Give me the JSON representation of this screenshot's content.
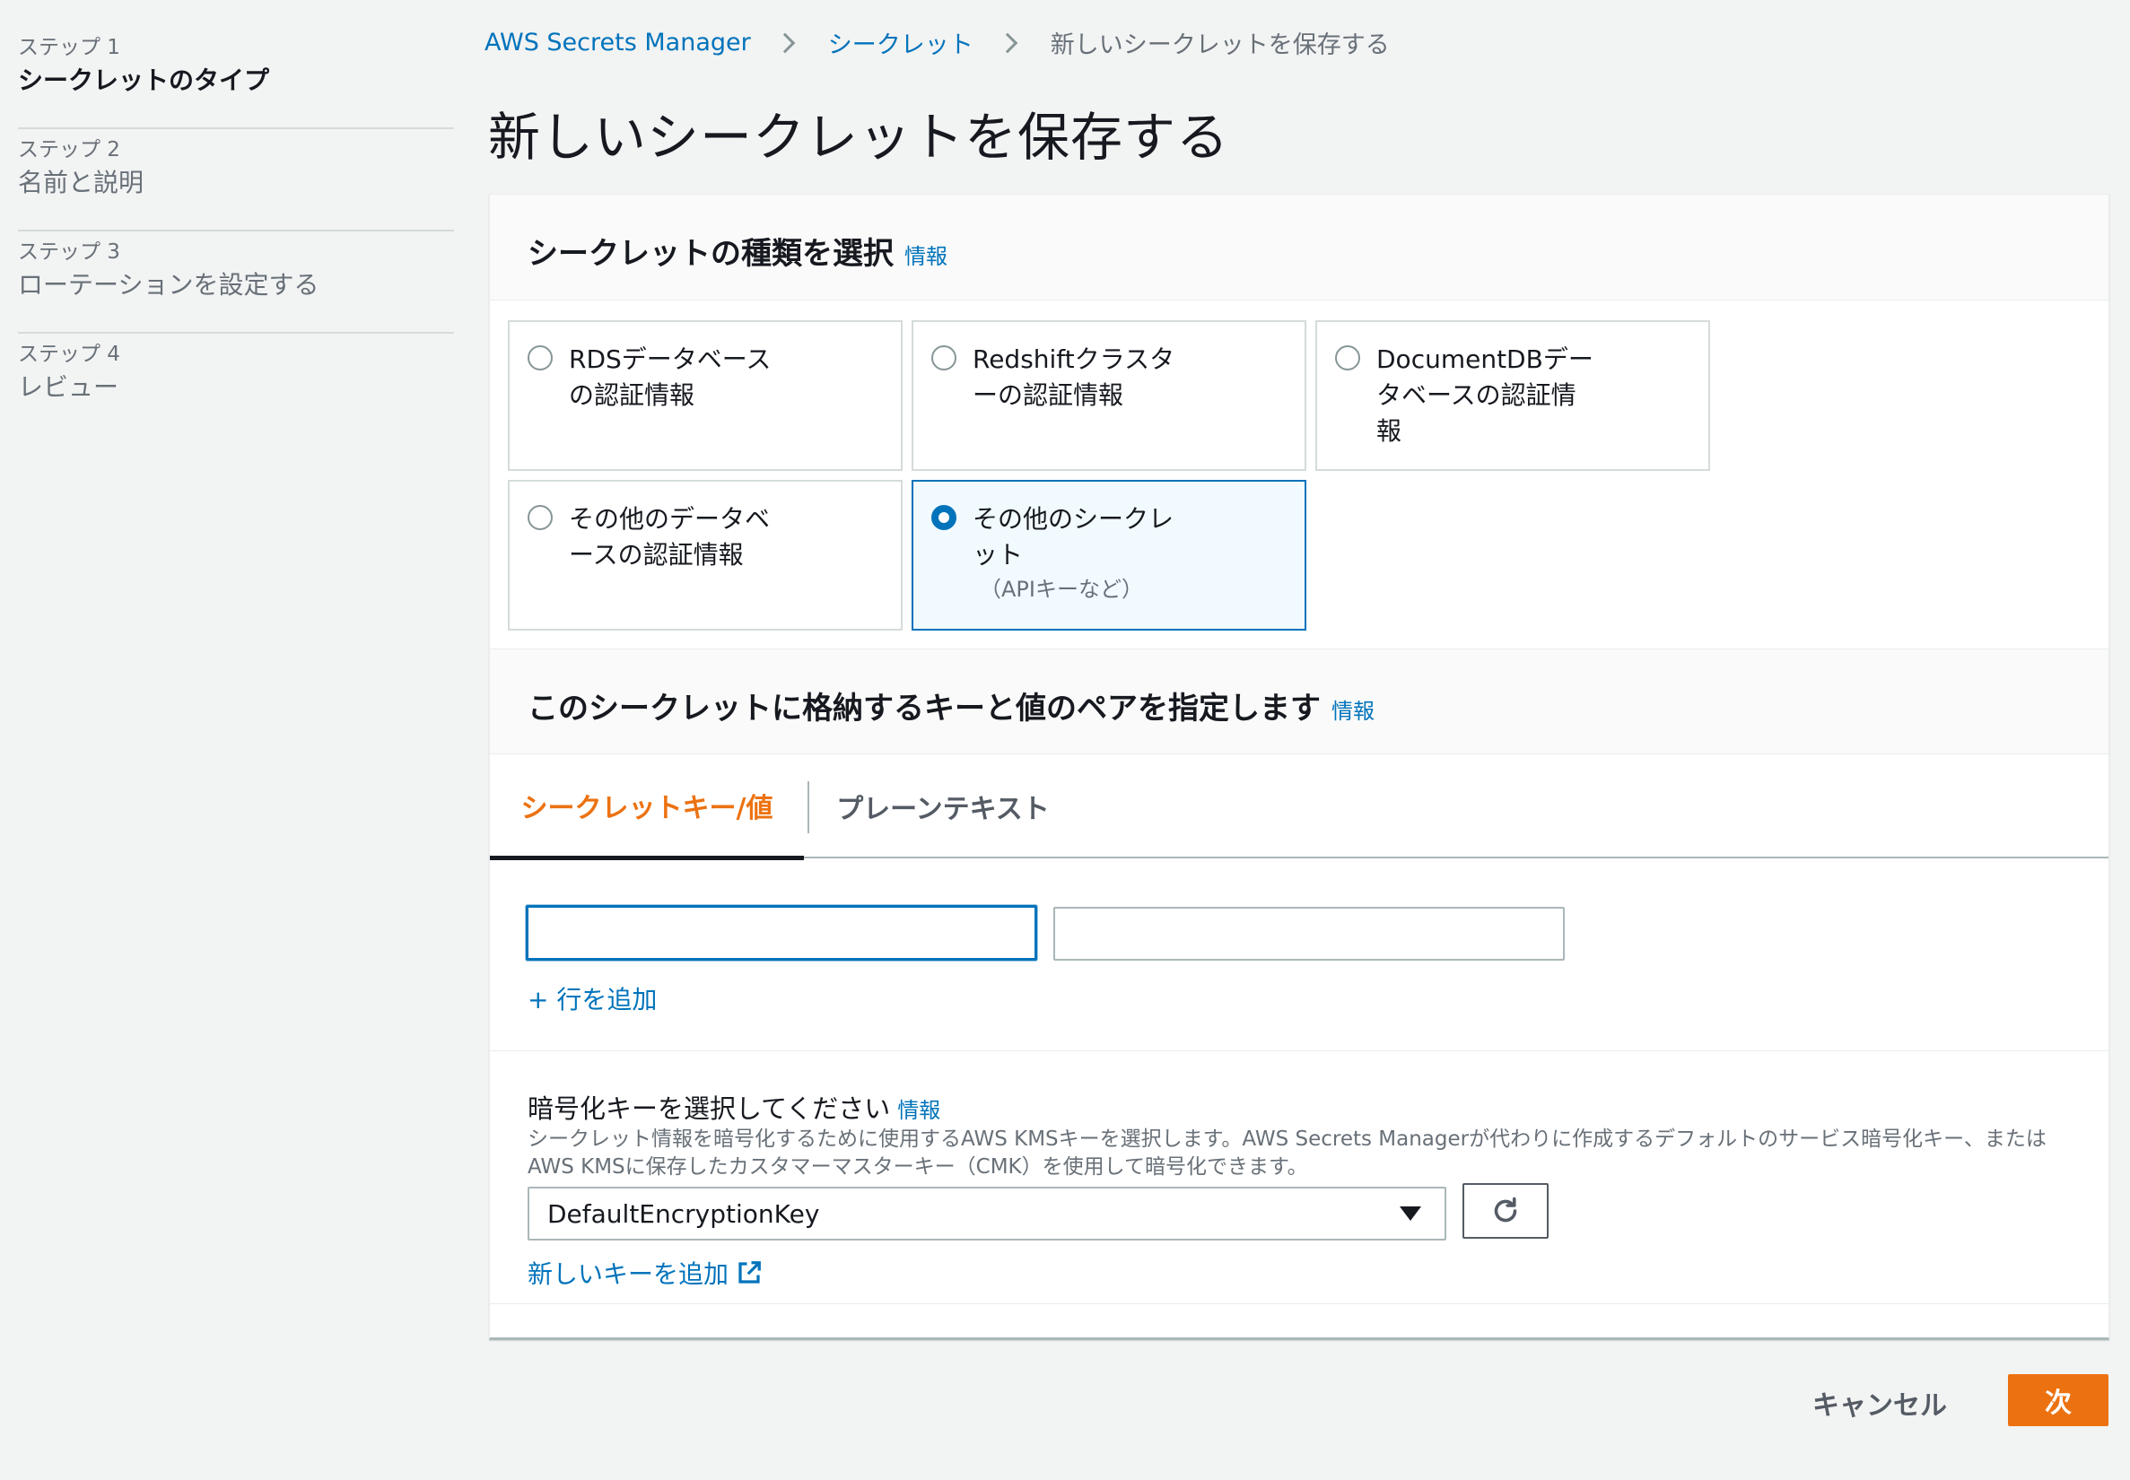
{
  "sidebar": {
    "steps": [
      {
        "number": "ステップ 1",
        "title": "シークレットのタイプ",
        "active": true
      },
      {
        "number": "ステップ 2",
        "title": "名前と説明",
        "active": false
      },
      {
        "number": "ステップ 3",
        "title": "ローテーションを設定する",
        "active": false
      },
      {
        "number": "ステップ 4",
        "title": "レビュー",
        "active": false
      }
    ]
  },
  "breadcrumb": {
    "service": "AWS Secrets Manager",
    "section": "シークレット",
    "current": "新しいシークレットを保存する"
  },
  "page_title": "新しいシークレットを保存する",
  "type_section": {
    "heading": "シークレットの種類を選択",
    "info": "情報",
    "options": [
      {
        "line1": "RDSデータベース",
        "line2": "の認証情報",
        "line3": "",
        "selected": false
      },
      {
        "line1": "Redshiftクラスタ",
        "line2": "ーの認証情報",
        "line3": "",
        "selected": false
      },
      {
        "line1": "DocumentDBデー",
        "line2": "タベースの認証情",
        "line3": "報",
        "selected": false
      },
      {
        "line1": "その他のデータベ",
        "line2": "ースの認証情報",
        "line3": "",
        "selected": false
      },
      {
        "line1": "その他のシークレ",
        "line2": "ット",
        "line3": "",
        "sub": "（APIキーなど）",
        "selected": true
      }
    ]
  },
  "kv_section": {
    "heading": "このシークレットに格納するキーと値のペアを指定します",
    "info": "情報",
    "tabs": [
      {
        "label": "シークレットキー/値",
        "active": true
      },
      {
        "label": "プレーンテキスト",
        "active": false
      }
    ],
    "key_value": "",
    "value_value": "",
    "add_row": "+ 行を追加"
  },
  "encryption": {
    "label": "暗号化キーを選択してください",
    "info": "情報",
    "description": "シークレット情報を暗号化するために使用するAWS KMSキーを選択します。AWS Secrets Managerが代わりに作成するデフォルトのサービス暗号化キー、またはAWS KMSに保存したカスタマーマスターキー（CMK）を使用して暗号化できます。",
    "selected": "DefaultEncryptionKey",
    "new_key_link": "新しいキーを追加"
  },
  "footer": {
    "cancel": "キャンセル",
    "next": "次"
  },
  "colors": {
    "link": "#0073bb",
    "accent": "#ec7211",
    "background": "#f2f3f3"
  }
}
